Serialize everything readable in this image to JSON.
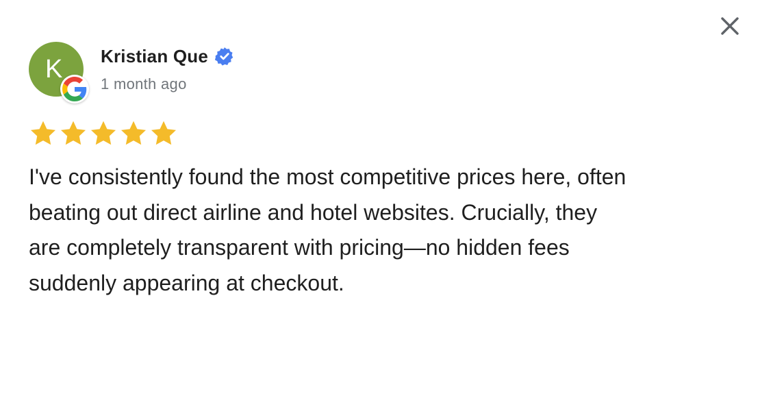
{
  "reviewer": {
    "name": "Kristian Que",
    "initial": "K",
    "avatar_color": "#7ca33e",
    "verified_icon": "verified-badge-icon",
    "badge_icon": "google-g-icon"
  },
  "review": {
    "time_ago": "1 month ago",
    "rating": 5,
    "max_rating": 5,
    "star_color": "#f4bb2a",
    "text": "I've consistently found the most competitive prices here, often\nbeating out direct airline and hotel websites. Crucially, they\nare completely transparent with pricing—no hidden fees\nsuddenly appearing at checkout."
  },
  "controls": {
    "close_icon": "close-icon"
  }
}
